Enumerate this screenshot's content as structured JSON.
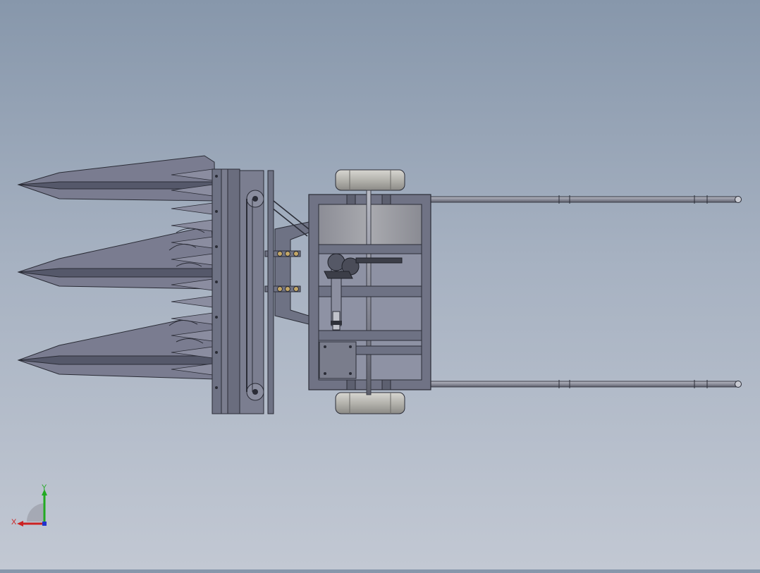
{
  "viewport": {
    "background_top": "#8797ab",
    "background_bottom": "#c2c8d3",
    "model": {
      "body_color": "#6e7284",
      "edge_color": "#2a2c36",
      "panel_color": "#9d9ea6",
      "rod_color": "#8e909e"
    }
  },
  "triad": {
    "x_label": "X",
    "y_label": "Y",
    "x_color": "#cc2222",
    "y_color": "#22aa22",
    "z_color": "#2233cc"
  }
}
